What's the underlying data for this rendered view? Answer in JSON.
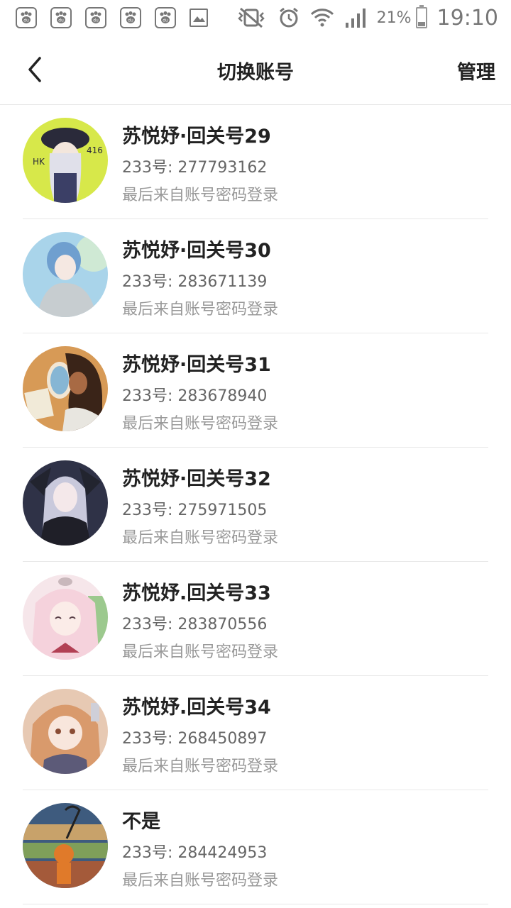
{
  "status_bar": {
    "notification_icons": [
      "baidu-paw-icon",
      "baidu-paw-icon",
      "baidu-paw-icon",
      "baidu-paw-icon",
      "baidu-paw-icon",
      "image-icon"
    ],
    "battery": "21%",
    "time": "19:10"
  },
  "nav": {
    "title": "切换账号",
    "manage_label": "管理"
  },
  "accounts": [
    {
      "name": "苏悦妤·回关号29",
      "id": "233号: 277793162",
      "login": "最后来自账号密码登录",
      "avatar_color": "#d7e84a"
    },
    {
      "name": "苏悦妤·回关号30",
      "id": "233号: 283671139",
      "login": "最后来自账号密码登录",
      "avatar_color": "#8fc4e0"
    },
    {
      "name": "苏悦妤·回关号31",
      "id": "233号: 283678940",
      "login": "最后来自账号密码登录",
      "avatar_color": "#c9894a"
    },
    {
      "name": "苏悦妤·回关号32",
      "id": "233号: 275971505",
      "login": "最后来自账号密码登录",
      "avatar_color": "#3a3d52"
    },
    {
      "name": "苏悦妤.回关号33",
      "id": "233号: 283870556",
      "login": "最后来自账号密码登录",
      "avatar_color": "#f2d8df"
    },
    {
      "name": "苏悦妤.回关号34",
      "id": "233号: 268450897",
      "login": "最后来自账号密码登录",
      "avatar_color": "#c8967a"
    },
    {
      "name": "不是",
      "id": "233号: 284424953",
      "login": "最后来自账号密码登录",
      "avatar_color": "#5f7fa3"
    }
  ]
}
